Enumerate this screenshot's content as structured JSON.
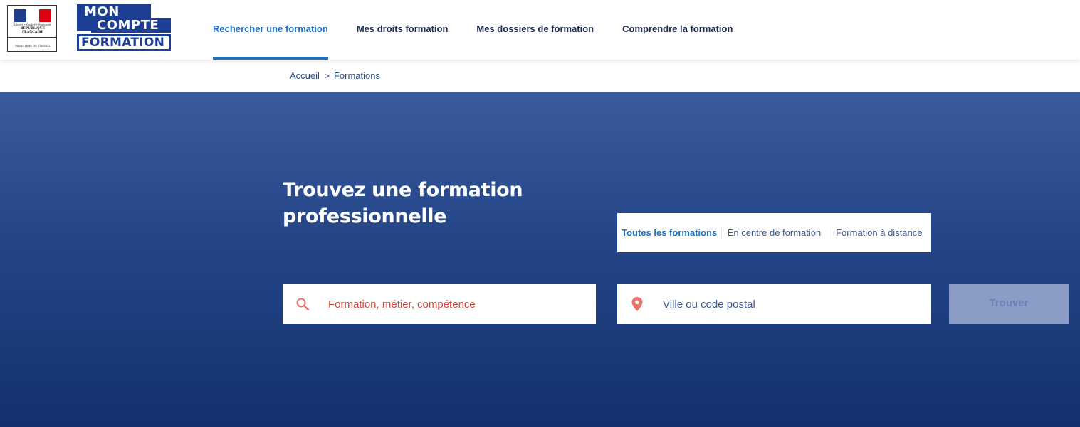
{
  "gov_logo": {
    "motto": "Liberté • Égalité • Fraternité",
    "republic": "RÉPUBLIQUE FRANÇAISE",
    "ministry": "MINISTÈRE DU TRAVAIL"
  },
  "brand": {
    "line1": "MON",
    "line2": "COMPTE",
    "line3": "FORMATION",
    "color": "#1c3f94"
  },
  "nav": {
    "items": [
      {
        "label": "Rechercher une formation",
        "active": true
      },
      {
        "label": "Mes droits formation",
        "active": false
      },
      {
        "label": "Mes dossiers de formation",
        "active": false
      },
      {
        "label": "Comprendre la formation",
        "active": false
      }
    ]
  },
  "breadcrumb": {
    "home": "Accueil",
    "separator": ">",
    "current": "Formations"
  },
  "hero": {
    "title": "Trouvez une formation professionnelle",
    "tabs": [
      {
        "label": "Toutes les formations",
        "active": true
      },
      {
        "label": "En centre de formation",
        "active": false
      },
      {
        "label": "Formation à distance",
        "active": false
      }
    ],
    "search": {
      "placeholder": "Formation, métier, compétence",
      "value": "",
      "icon": "search-icon"
    },
    "location": {
      "placeholder": "Ville ou code postal",
      "value": "",
      "icon": "map-pin-icon"
    },
    "submit_label": "Trouver"
  },
  "colors": {
    "accent": "#1f6fc2",
    "hero_top": "#3a5c9e",
    "hero_bottom": "#13306e",
    "icon": "#e8736a",
    "button_disabled": "#8b9dc6"
  }
}
